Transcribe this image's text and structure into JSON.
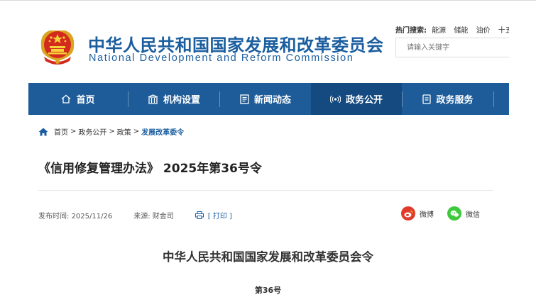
{
  "header": {
    "title_cn": "中华人民共和国国家发展和改革委员会",
    "title_en": "National Development and Reform Commission",
    "emblem_icon": "national-emblem-icon",
    "hot_search_label": "热门搜索:",
    "hot_search_items": [
      "能源",
      "储能",
      "油价",
      "十五五"
    ],
    "search_placeholder": "请输入关键字"
  },
  "nav": {
    "items": [
      {
        "label": "首页",
        "icon": "home-icon"
      },
      {
        "label": "机构设置",
        "icon": "building-icon"
      },
      {
        "label": "新闻动态",
        "icon": "news-icon"
      },
      {
        "label": "政务公开",
        "icon": "broadcast-icon"
      },
      {
        "label": "政务服务",
        "icon": "service-icon"
      }
    ],
    "active_index": 3
  },
  "breadcrumb": {
    "items": [
      "首页",
      "政务公开",
      "政策",
      "发展改革委令"
    ],
    "separator": ">"
  },
  "article": {
    "title": "《信用修复管理办法》 2025年第36号令",
    "publish_label": "发布时间:",
    "publish_date": "2025/11/26",
    "source_label": "来源:",
    "source": "财金司",
    "print_label": "[ 打印 ]",
    "share_weibo": "微博",
    "share_wechat": "微信",
    "doc_heading": "中华人民共和国国家发展和改革委员会令",
    "doc_number": "第36号"
  },
  "colors": {
    "brand_blue": "#1b5e9f",
    "nav_bg": "#1d5c99",
    "nav_active": "#144a80",
    "weibo": "#e03a2a",
    "wechat": "#3ec83c"
  }
}
